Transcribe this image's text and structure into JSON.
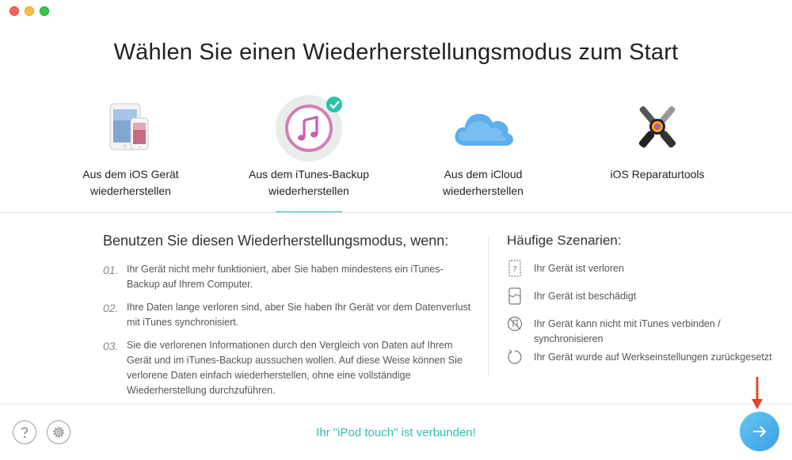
{
  "window": {
    "controls": [
      "close",
      "minimize",
      "maximize"
    ]
  },
  "title": "Wählen Sie einen Wiederherstellungsmodus zum Start",
  "modes": [
    {
      "icon": "ios-devices-icon",
      "line1": "Aus dem iOS Gerät",
      "line2": "wiederherstellen",
      "selected": false
    },
    {
      "icon": "itunes-icon",
      "line1": "Aus dem iTunes-Backup",
      "line2": "wiederherstellen",
      "selected": true
    },
    {
      "icon": "icloud-icon",
      "line1": "Aus dem iCloud",
      "line2": "wiederherstellen",
      "selected": false
    },
    {
      "icon": "repair-tools-icon",
      "line1": "iOS Reparaturtools",
      "line2": "",
      "selected": false
    }
  ],
  "usage": {
    "heading": "Benutzen Sie diesen Wiederherstellungsmodus, wenn:",
    "items": [
      {
        "num": "01.",
        "text": "Ihr Gerät nicht mehr funktioniert, aber Sie haben mindestens ein iTunes-Backup auf Ihrem Computer."
      },
      {
        "num": "02.",
        "text": "Ihre Daten lange verloren sind, aber Sie haben Ihr Gerät vor dem Datenverlust mit iTunes synchronisiert."
      },
      {
        "num": "03.",
        "text": "Sie die verlorenen Informationen durch den Vergleich von Daten auf Ihrem Gerät und im iTunes-Backup aussuchen wollen. Auf diese Weise können Sie verlorene Daten einfach wiederherstellen, ohne eine vollständige Wiederherstellung durchzuführen."
      }
    ]
  },
  "scenarios": {
    "heading": "Häufige Szenarien:",
    "items": [
      {
        "icon": "lost-device-icon",
        "text": "Ihr Gerät ist verloren"
      },
      {
        "icon": "broken-device-icon",
        "text": "Ihr Gerät ist beschädigt"
      },
      {
        "icon": "itunes-disconnected-icon",
        "text": "Ihr Gerät kann nicht mit iTunes verbinden / synchronisieren"
      },
      {
        "icon": "factory-reset-icon",
        "text": "Ihr Gerät wurde auf Werkseinstellungen zurückgesetzt"
      }
    ]
  },
  "footer": {
    "status": "Ihr \"iPod touch\" ist verbunden!",
    "help_icon": "help-icon",
    "settings_icon": "gear-icon",
    "next_icon": "arrow-right-icon"
  },
  "colors": {
    "accent": "#2dbfb0",
    "next_button": "#4aaeea",
    "annotation_arrow": "#e8442a"
  }
}
